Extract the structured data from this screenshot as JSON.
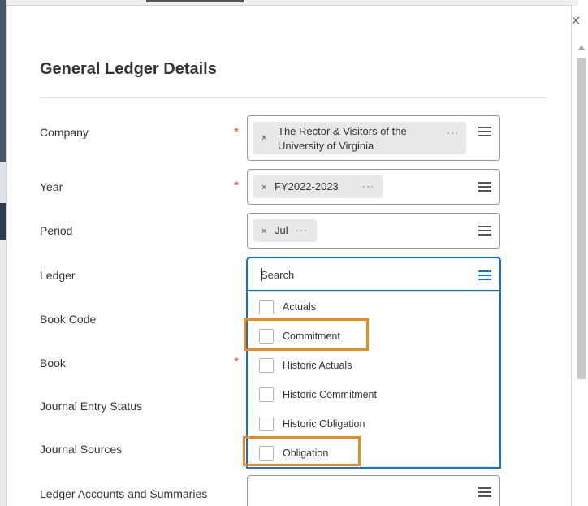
{
  "dialog": {
    "title": "General Ledger Details",
    "close_glyph": "×"
  },
  "fields": {
    "company": {
      "label": "Company",
      "required": true,
      "chip_line1": "The Rector & Visitors of the",
      "chip_line2": "University of Virginia"
    },
    "year": {
      "label": "Year",
      "required": true,
      "chip": "FY2022-2023"
    },
    "period": {
      "label": "Period",
      "required": false,
      "chip": "Jul"
    },
    "ledger": {
      "label": "Ledger",
      "search_placeholder": "Search",
      "options": [
        {
          "label": "Actuals",
          "checked": false,
          "highlighted": false
        },
        {
          "label": "Commitment",
          "checked": false,
          "highlighted": true
        },
        {
          "label": "Historic Actuals",
          "checked": false,
          "highlighted": false
        },
        {
          "label": "Historic Commitment",
          "checked": false,
          "highlighted": false
        },
        {
          "label": "Historic Obligation",
          "checked": false,
          "highlighted": false
        },
        {
          "label": "Obligation",
          "checked": false,
          "highlighted": true
        }
      ]
    },
    "book_code": {
      "label": "Book Code"
    },
    "book": {
      "label": "Book",
      "required": true
    },
    "journal_entry_status": {
      "label": "Journal Entry Status"
    },
    "journal_sources": {
      "label": "Journal Sources"
    },
    "ledger_accounts": {
      "label": "Ledger Accounts and Summaries"
    }
  },
  "glyphs": {
    "required": "*",
    "remove": "×",
    "more": "···"
  },
  "colors": {
    "accent": "#0875e1",
    "required": "#de2b2b",
    "highlight": "#ef8a17",
    "chip_bg": "#e8e8e8"
  },
  "icons": {
    "list": "prompt-list-icon",
    "close": "close-icon",
    "remove": "remove-x-icon",
    "more": "ellipsis-icon"
  }
}
